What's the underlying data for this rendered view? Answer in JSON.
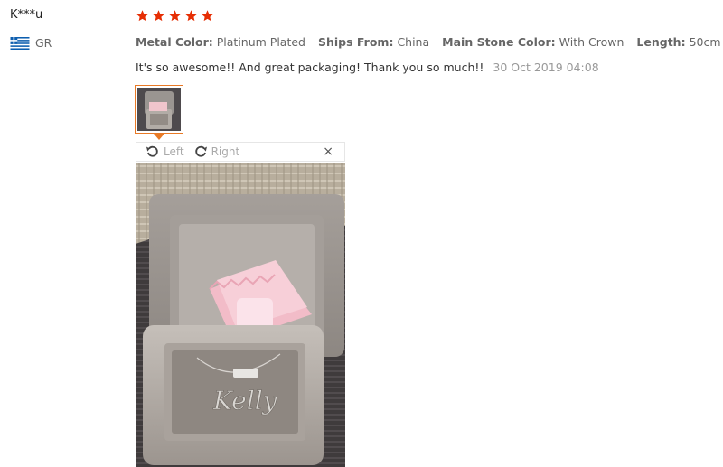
{
  "reviewer": {
    "name": "K***u",
    "country_code": "GR"
  },
  "rating": {
    "stars": 5,
    "max": 5,
    "color": "#e62e04"
  },
  "attributes": [
    {
      "label": "Metal Color:",
      "value": "Platinum Plated"
    },
    {
      "label": "Ships From:",
      "value": "China"
    },
    {
      "label": "Main Stone Color:",
      "value": "With Crown"
    },
    {
      "label": "Length:",
      "value": "50cm"
    }
  ],
  "review": {
    "text": "It's so awesome!! And great packaging! Thank you so much!!",
    "date": "30 Oct 2019 04:08"
  },
  "viewer": {
    "rotate_left_label": "Left",
    "rotate_right_label": "Right",
    "close_symbol": "×",
    "accent_color": "#e97a26"
  }
}
